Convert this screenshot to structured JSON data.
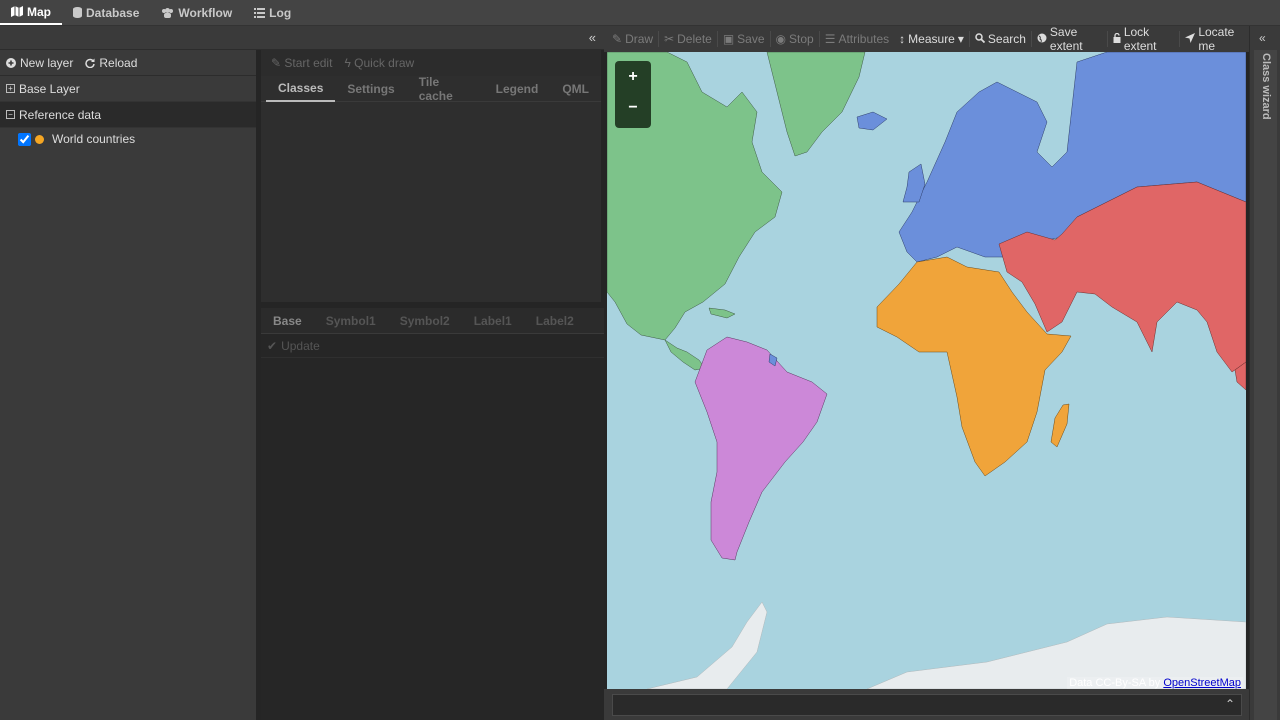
{
  "nav": {
    "tabs": [
      {
        "label": "Map",
        "icon": "map-icon"
      },
      {
        "label": "Database",
        "icon": "database-icon"
      },
      {
        "label": "Workflow",
        "icon": "workflow-icon"
      },
      {
        "label": "Log",
        "icon": "list-icon"
      }
    ]
  },
  "layers": {
    "new_layer": "New layer",
    "reload": "Reload",
    "groups": [
      {
        "label": "Base Layer",
        "state": "collapsed"
      },
      {
        "label": "Reference data",
        "state": "expanded"
      }
    ],
    "items": [
      {
        "label": "World countries",
        "checked": true,
        "swatch": "#f5a623"
      }
    ]
  },
  "editor": {
    "start_edit": "Start edit",
    "quick_draw": "Quick draw",
    "tabs": [
      "Classes",
      "Settings",
      "Tile cache",
      "Legend",
      "QML"
    ],
    "style_tabs": [
      "Base",
      "Symbol1",
      "Symbol2",
      "Label1",
      "Label2"
    ],
    "update": "Update"
  },
  "map_toolbar": {
    "draw": "Draw",
    "delete": "Delete",
    "save": "Save",
    "stop": "Stop",
    "attributes": "Attributes",
    "measure": "Measure",
    "search": "Search",
    "save_extent": "Save extent",
    "lock_extent": "Lock extent",
    "locate_me": "Locate me"
  },
  "map": {
    "zoom_in": "+",
    "zoom_out": "−",
    "attribution": "Data CC-By-SA by",
    "attribution_link": "OpenStreetMap",
    "colors": {
      "water": "#a9d3df",
      "north_america": "#7dc38a",
      "europe_russia": "#6b8fdb",
      "asia": "#e06666",
      "africa": "#f0a43a",
      "south_america": "#cc88d8",
      "ice": "#e8ecee"
    }
  },
  "side": {
    "class_wizard": "Class wizard"
  }
}
